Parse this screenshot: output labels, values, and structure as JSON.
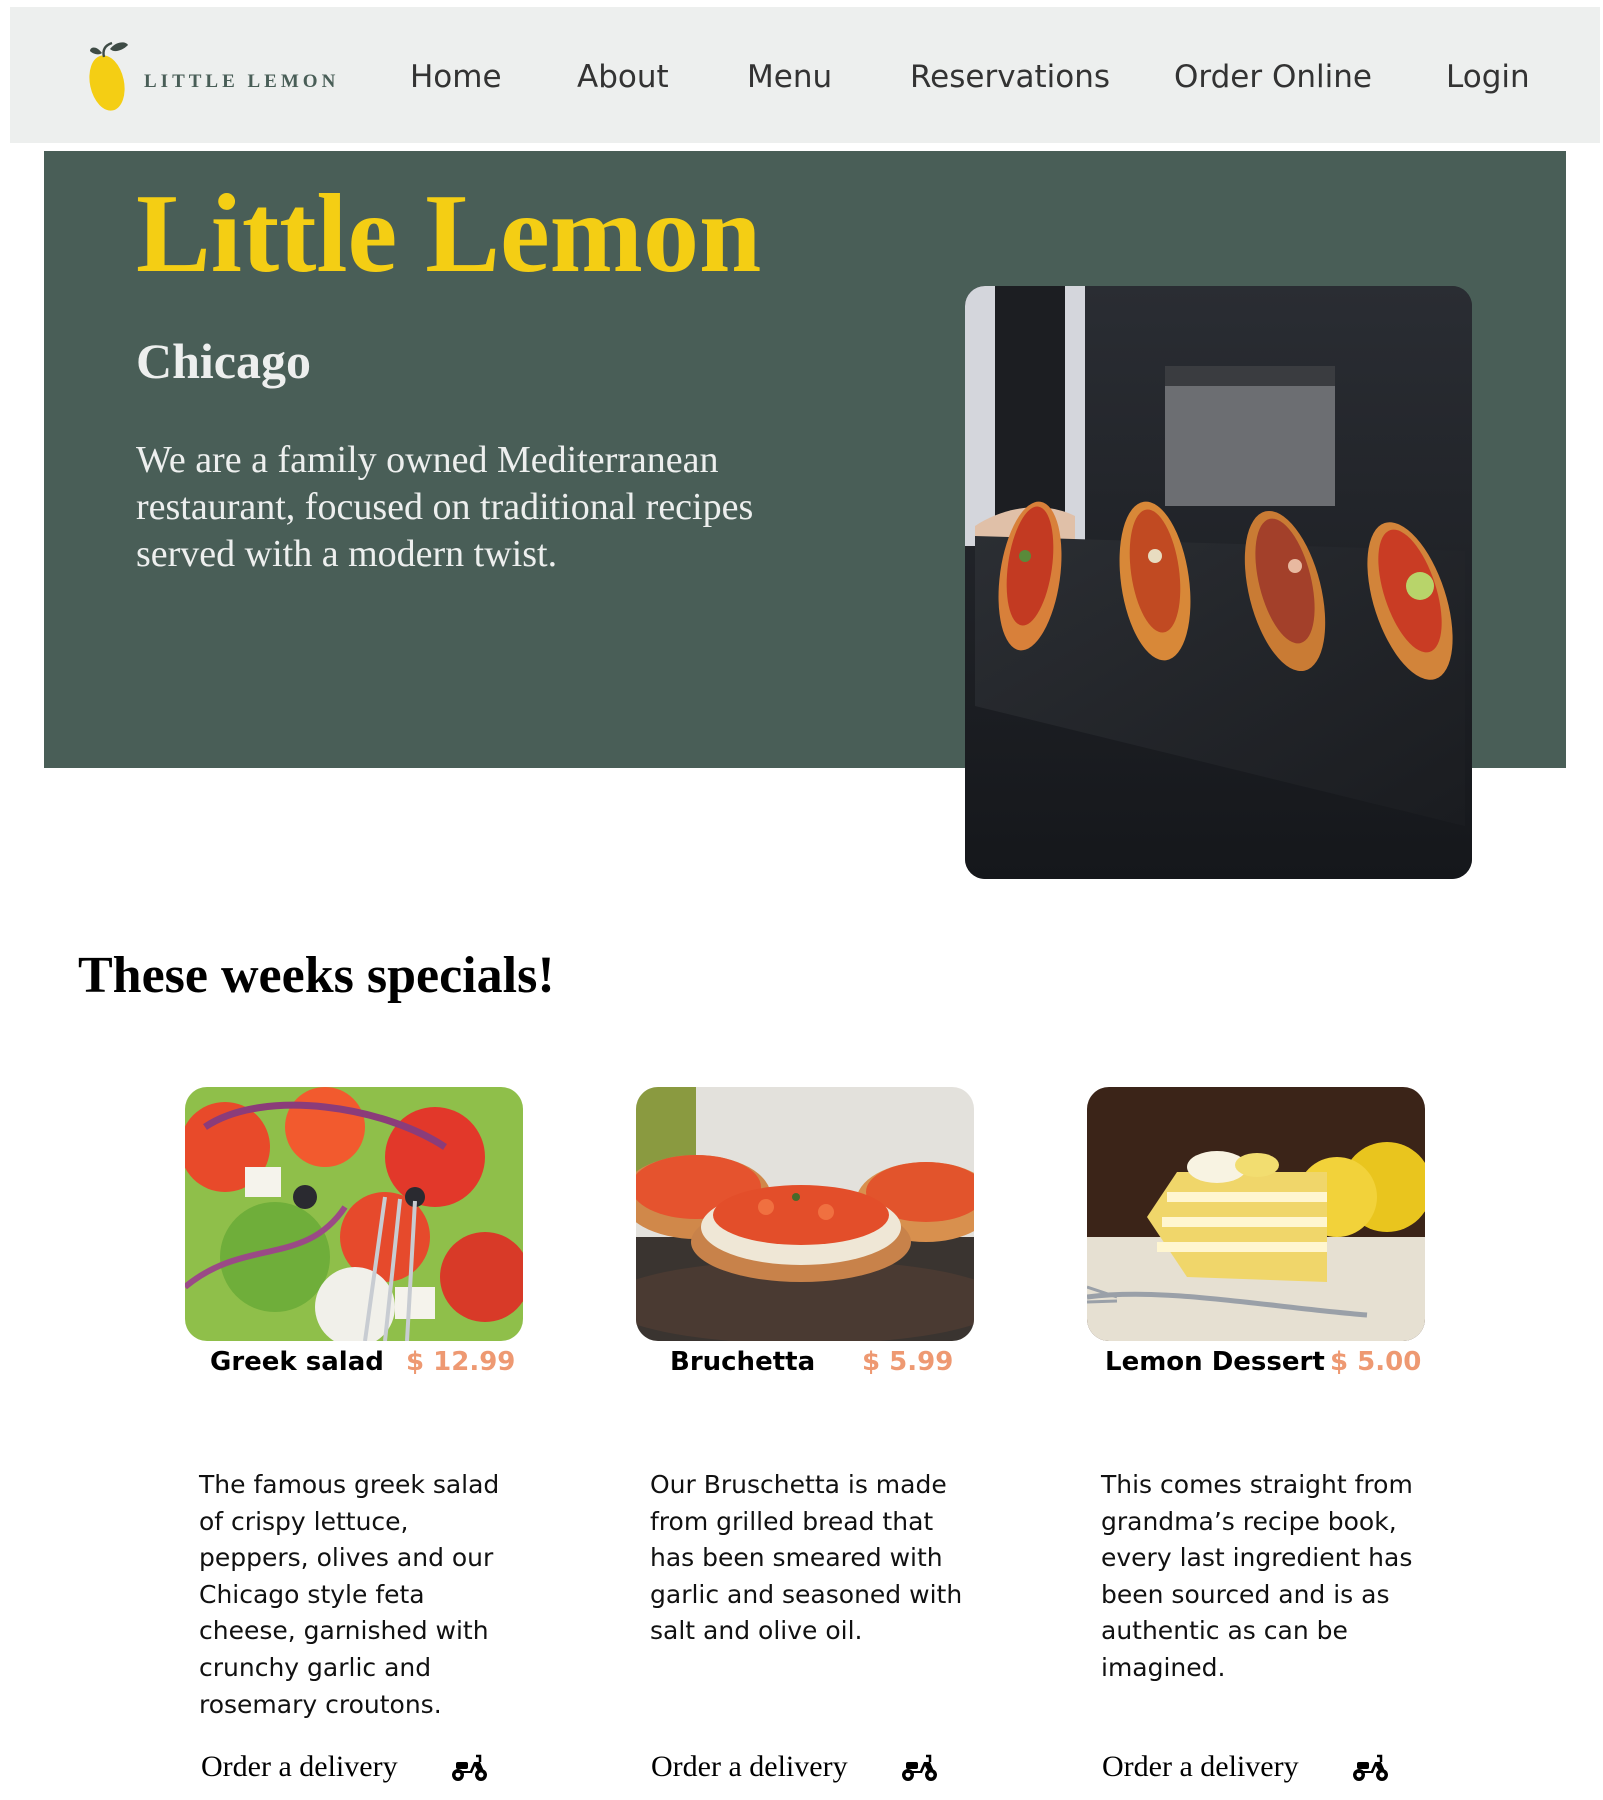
{
  "header": {
    "logo_text": "LITTLE LEMON",
    "logo_icon": "lemon-icon",
    "nav": [
      {
        "label": "Home"
      },
      {
        "label": "About"
      },
      {
        "label": "Menu"
      },
      {
        "label": "Reservations"
      },
      {
        "label": "Order Online"
      },
      {
        "label": "Login"
      }
    ]
  },
  "hero": {
    "title": "Little Lemon",
    "city": "Chicago",
    "description": "We are a family owned Mediterranean restaurant, focused on traditional recipes served with a modern twist.",
    "image": "chef-holding-bruschetta-platter"
  },
  "specials": {
    "title": "These weeks specials!",
    "items": [
      {
        "name": "Greek salad",
        "price": "$ 12.99",
        "description": "The famous greek salad of crispy lettuce, peppers, olives and our Chicago style feta cheese, garnished with crunchy garlic and rosemary croutons.",
        "order_label": "Order a delivery",
        "image": "greek-salad-photo"
      },
      {
        "name": "Bruchetta",
        "price": "$ 5.99",
        "description": "Our Bruschetta is made from grilled bread that has been smeared with garlic and seasoned with salt and olive oil.",
        "order_label": "Order a delivery",
        "image": "bruschetta-photo"
      },
      {
        "name": "Lemon Dessert",
        "price": "$ 5.00",
        "description": "This comes straight from grandma’s recipe book, every last ingredient has been sourced and is as authentic as can be imagined.",
        "order_label": "Order a delivery",
        "image": "lemon-dessert-photo"
      }
    ],
    "order_icon": "scooter-icon"
  },
  "colors": {
    "nav_bg": "#edefee",
    "hero_bg": "#495e57",
    "accent_yellow": "#f4ce14",
    "price_salmon": "#ee9972"
  }
}
